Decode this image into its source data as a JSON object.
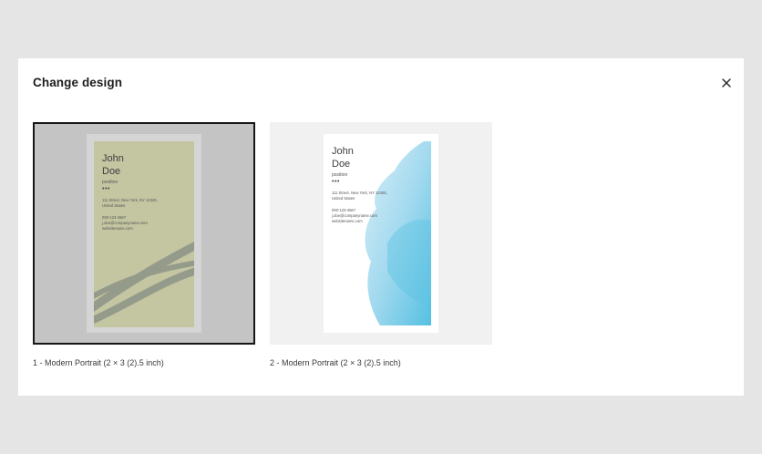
{
  "dialog": {
    "title": "Change design",
    "close_icon": "close-icon"
  },
  "designs": [
    {
      "caption": "1 - Modern Portrait (2 × 3 (2).5 inch)",
      "selected": true,
      "card": {
        "first_name": "John",
        "last_name": "Doe",
        "position": "position",
        "dots": "•••",
        "address_1": "111 Street, New York, NY 12345,",
        "address_2": "United States",
        "phone": "000-123-4567",
        "email": "j.doe@companyname.com",
        "website": "websitename.com",
        "background": "#c3c6a1",
        "accent": "#8f9685"
      }
    },
    {
      "caption": "2 - Modern Portrait (2 × 3 (2).5 inch)",
      "selected": false,
      "card": {
        "first_name": "John",
        "last_name": "Doe",
        "position": "position",
        "dots": "•••",
        "address_1": "111 Street, New York, NY 12345,",
        "address_2": "United States",
        "phone": "000-123-4567",
        "email": "j.doe@companyname.com",
        "website": "websitename.com",
        "background": "#ffffff",
        "accent": "#5ec4e3"
      }
    }
  ]
}
